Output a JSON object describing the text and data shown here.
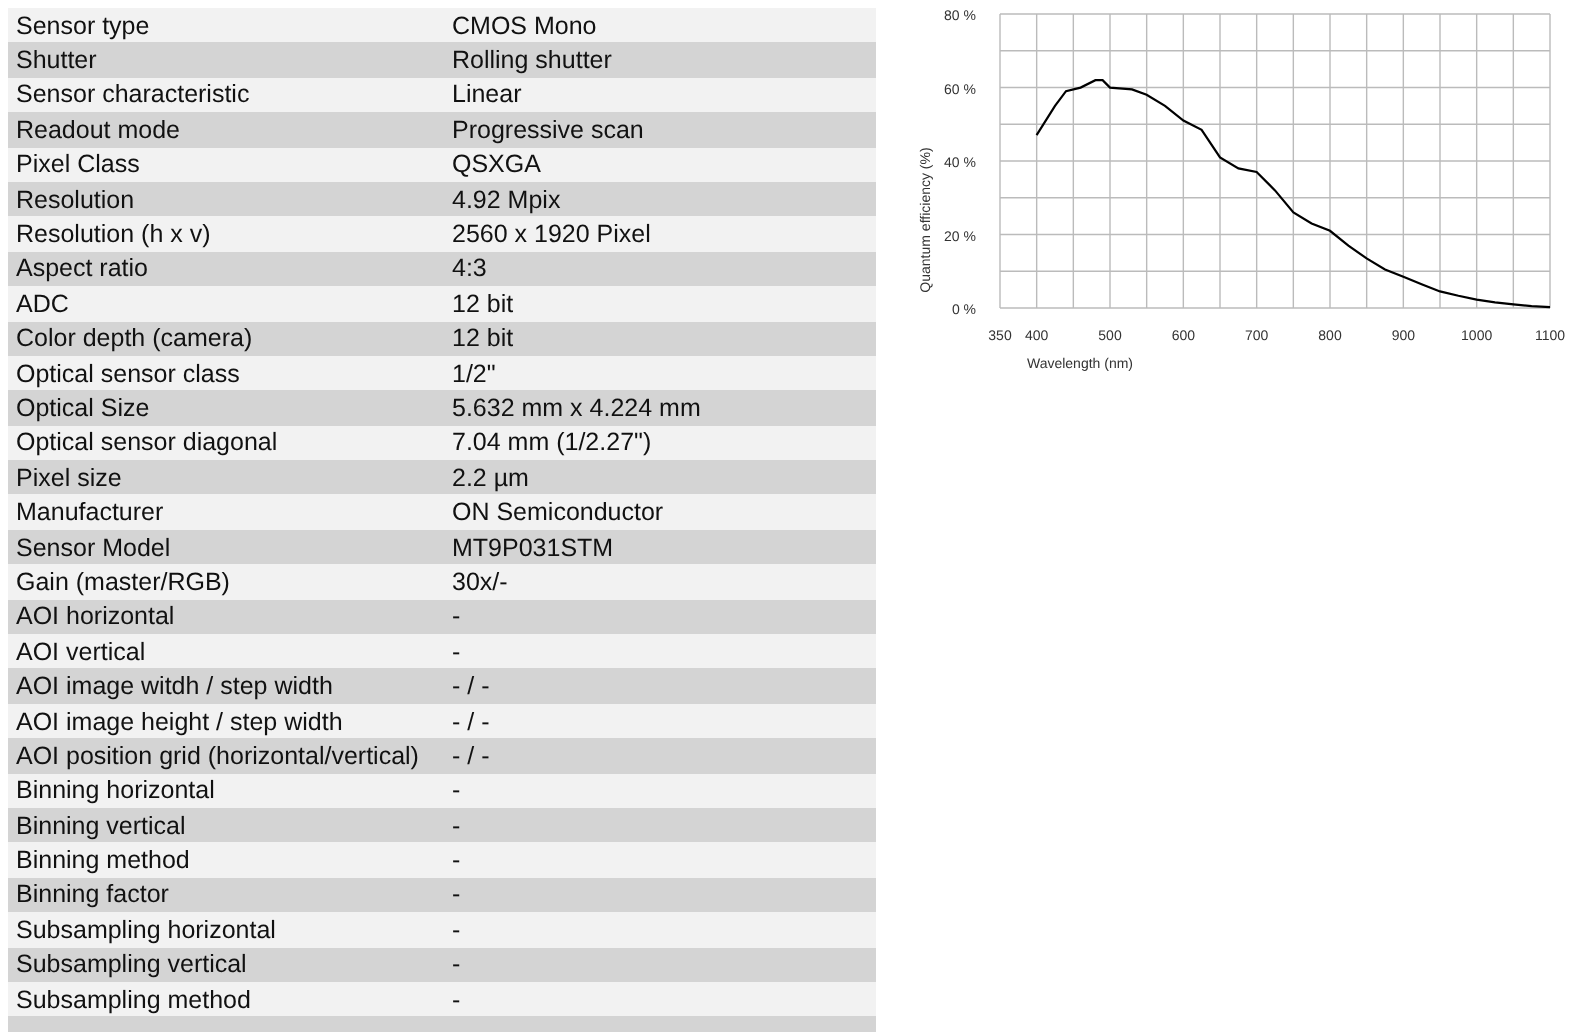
{
  "specs": [
    {
      "label": "Sensor type",
      "value": "CMOS Mono"
    },
    {
      "label": "Shutter",
      "value": "Rolling shutter"
    },
    {
      "label": "Sensor characteristic",
      "value": "Linear"
    },
    {
      "label": "Readout mode",
      "value": "Progressive scan"
    },
    {
      "label": "Pixel Class",
      "value": "QSXGA"
    },
    {
      "label": "Resolution",
      "value": "4.92 Mpix"
    },
    {
      "label": "Resolution (h x v)",
      "value": "2560 x 1920 Pixel"
    },
    {
      "label": "Aspect ratio",
      "value": "4:3"
    },
    {
      "label": "ADC",
      "value": "12 bit"
    },
    {
      "label": "Color depth (camera)",
      "value": "12 bit"
    },
    {
      "label": "Optical sensor class",
      "value": "1/2\""
    },
    {
      "label": "Optical Size",
      "value": "5.632 mm x 4.224 mm"
    },
    {
      "label": "Optical sensor diagonal",
      "value": "7.04 mm (1/2.27\")"
    },
    {
      "label": "Pixel size",
      "value": "2.2 µm"
    },
    {
      "label": "Manufacturer",
      "value": "ON Semiconductor"
    },
    {
      "label": "Sensor Model",
      "value": "MT9P031STM"
    },
    {
      "label": "Gain (master/RGB)",
      "value": "30x/-"
    },
    {
      "label": "AOI horizontal",
      "value": "-"
    },
    {
      "label": "AOI vertical",
      "value": "-"
    },
    {
      "label": "AOI image witdh / step width",
      "value": "- / -"
    },
    {
      "label": "AOI image height / step width",
      "value": "- / -"
    },
    {
      "label": "AOI position grid (horizontal/vertical)",
      "value": "- / -"
    },
    {
      "label": "Binning horizontal",
      "value": "-"
    },
    {
      "label": "Binning vertical",
      "value": "-"
    },
    {
      "label": "Binning method",
      "value": "-"
    },
    {
      "label": "Binning factor",
      "value": "-"
    },
    {
      "label": "Subsampling horizontal",
      "value": "-"
    },
    {
      "label": "Subsampling vertical",
      "value": "-"
    },
    {
      "label": "Subsampling method",
      "value": "-"
    }
  ],
  "qe_chart": {
    "chart_data": {
      "type": "line",
      "xlabel": "Wavelength (nm)",
      "ylabel": "Quantum efficiency (%)",
      "x": [
        400,
        425,
        440,
        460,
        480,
        490,
        500,
        530,
        550,
        575,
        600,
        625,
        650,
        675,
        700,
        725,
        750,
        775,
        800,
        825,
        850,
        875,
        900,
        925,
        950,
        975,
        1000,
        1025,
        1050,
        1075,
        1100
      ],
      "grid": true,
      "series": [
        {
          "color": "#000000",
          "values": [
            47,
            55,
            59,
            60,
            62,
            62,
            60,
            59.5,
            58,
            55,
            51,
            48.5,
            41,
            38,
            37,
            32,
            26,
            23,
            21,
            17,
            13.5,
            10.5,
            8.5,
            6.5,
            4.5,
            3.3,
            2.3,
            1.5,
            1,
            0.5,
            0.2
          ]
        }
      ],
      "xlim": [
        350,
        1100
      ],
      "ylim": [
        0,
        80
      ],
      "xticks": [
        350,
        400,
        500,
        600,
        700,
        800,
        900,
        1000,
        1100
      ],
      "yticks": [
        {
          "value": 0,
          "label": "0 %"
        },
        {
          "value": 20,
          "label": "20 %"
        },
        {
          "value": 40,
          "label": "40 %"
        },
        {
          "value": 60,
          "label": "60 %"
        },
        {
          "value": 80,
          "label": "80 %"
        }
      ]
    }
  }
}
